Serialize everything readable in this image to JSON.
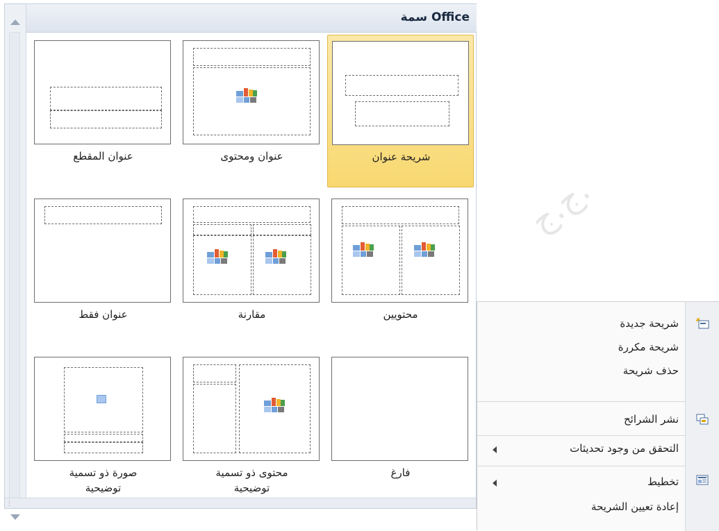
{
  "gallery": {
    "title": "سمة Office",
    "layouts": [
      {
        "id": "title-slide",
        "label": "شريحة عنوان",
        "selected": true
      },
      {
        "id": "title-and-content",
        "label": "عنوان ومحتوى",
        "selected": false
      },
      {
        "id": "section-header",
        "label": "عنوان المقطع",
        "selected": false
      },
      {
        "id": "two-content",
        "label": "محتويين",
        "selected": false
      },
      {
        "id": "comparison",
        "label": "مقارنة",
        "selected": false
      },
      {
        "id": "title-only",
        "label": "عنوان فقط",
        "selected": false
      },
      {
        "id": "blank",
        "label": "فارغ",
        "selected": false
      },
      {
        "id": "content-with-caption",
        "label": "محتوى ذو تسمية\nتوضيحية",
        "selected": false
      },
      {
        "id": "picture-with-caption",
        "label": "صورة ذو تسمية\nتوضيحية",
        "selected": false
      }
    ]
  },
  "menu": {
    "items": [
      {
        "id": "new-slide",
        "label": "شريحة جديدة",
        "icon": "new-slide-icon",
        "has_submenu": false
      },
      {
        "id": "duplicate-slide",
        "label": "شريحة مكررة",
        "icon": "",
        "has_submenu": false
      },
      {
        "id": "delete-slide",
        "label": "حذف شريحة",
        "icon": "",
        "has_submenu": false
      },
      {
        "id": "publish-slides",
        "label": "نشر الشرائح",
        "icon": "publish-slides-icon",
        "has_submenu": false
      },
      {
        "id": "check-updates",
        "label": "التحقق من وجود تحديثات",
        "icon": "",
        "has_submenu": true
      },
      {
        "id": "layout",
        "label": "تخطيط",
        "icon": "layout-icon",
        "has_submenu": true
      },
      {
        "id": "reset-slide",
        "label": "إعادة تعيين الشريحة",
        "icon": "",
        "has_submenu": false
      }
    ]
  },
  "watermark": "ج.ج.",
  "colors": {
    "selected_bg": "#f8d870",
    "header_bg": "#dde4ee"
  }
}
